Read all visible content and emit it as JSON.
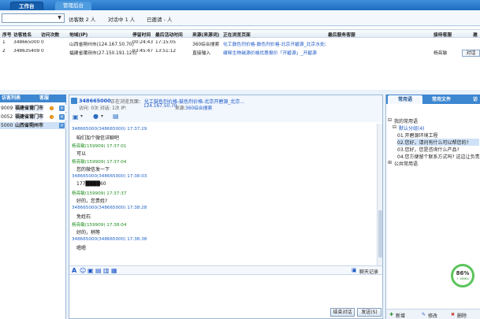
{
  "tabs": [
    {
      "label": "工作台"
    },
    {
      "label": "管理后台"
    }
  ],
  "filter": {
    "select_value": "",
    "visitors": "访客数 2 人",
    "chatting": "对话中 1 人",
    "invited": "已邀请 - 人"
  },
  "grid": {
    "headers": [
      "序号",
      "访客姓名",
      "访问次数",
      "地域(IP)",
      "停留时间",
      "最后活动时间",
      "来源(来源词)",
      "正在浏览页面",
      "最后服务客服",
      "接待客服",
      "邀"
    ],
    "rows": [
      {
        "no": "1",
        "name": "348665000",
        "visits": "0",
        "region": "山西省朔州市(124.167.50.70)",
        "stay": "00:24:43",
        "last": "17:15:05",
        "source": "360综合搜索",
        "page": "化工鼓色剂价格-鼓色剂价格-北京开碧源_北京水处理...",
        "last_agent": "",
        "agent": "",
        "invite": ""
      },
      {
        "no": "2",
        "name": "348635409",
        "visits": "0",
        "region": "福建省莆田市(27.150.191.125)",
        "stay": "03:45:47",
        "last": "13:51:12",
        "source": "直接输入",
        "page": "缓释生物碳源价格优惠报价「开碧源」_开碧源",
        "last_agent": "",
        "agent": "杨亮敏",
        "invite": "对话"
      }
    ]
  },
  "left": {
    "tabs": [
      "访客列表",
      "客服"
    ],
    "items": [
      {
        "id": "9009",
        "name": "福建省莆门市"
      },
      {
        "id": "0052",
        "name": "福建省莆门市"
      },
      {
        "id": "5000",
        "name": "山西省朔州市"
      }
    ]
  },
  "chat": {
    "title": "348665000",
    "status": "正在浏览页面：",
    "page": "化工鼓色剂价格-鼓色剂价格-北京开碧源_北京...",
    "info_prefix": "访问: 0次 对话: 1次 IP:",
    "ip": "124.167.50.70",
    "source_prefix": "来源:",
    "source": "360综合搜索",
    "messages": [
      {
        "who": "cust",
        "meta": "348665000(348665000)  17:37:29",
        "text": "咱们加个微信详聊吧"
      },
      {
        "who": "agent",
        "meta": "杨亮敏(159909)  17:37:01",
        "text": "可以"
      },
      {
        "who": "agent",
        "meta": "杨亮敏(159909)  17:37:04",
        "text": "您的微信发一下"
      },
      {
        "who": "cust",
        "meta": "348665000(348665000)  17:38:03",
        "text": "177████60"
      },
      {
        "who": "agent",
        "meta": "杨亮敏(159909)  17:37:37",
        "text": "好的，您贵姓?"
      },
      {
        "who": "cust",
        "meta": "348665000(348665000)  17:38:28",
        "text": "免姓石"
      },
      {
        "who": "agent",
        "meta": "杨亮敏(159909)  17:38:04",
        "text": "好的，稍等"
      },
      {
        "who": "cust",
        "meta": "348665000(348665000)  17:38:38",
        "text": "嗯嗯"
      }
    ],
    "history_label": "聊天记录",
    "end_label": "结束对话",
    "send_label": "发送(S)"
  },
  "right": {
    "tabs": [
      "常用语",
      "常用文件",
      "访"
    ],
    "my_phrases": "我的常用语",
    "default_group": "默认分组(4)",
    "phrases": [
      "01.开碧源环境工程",
      "02.您好，请问有什么可以帮您的?",
      "03.您好，您是咨询什么产品?",
      "04.您方便留个联系方式吗? 这边让负责人..."
    ],
    "public_phrases": "公共常用语",
    "add_label": "新增",
    "edit_label": "修改",
    "delete_label": "删除"
  },
  "gauge": {
    "value": "86%",
    "rate": "+ 188K/s"
  }
}
